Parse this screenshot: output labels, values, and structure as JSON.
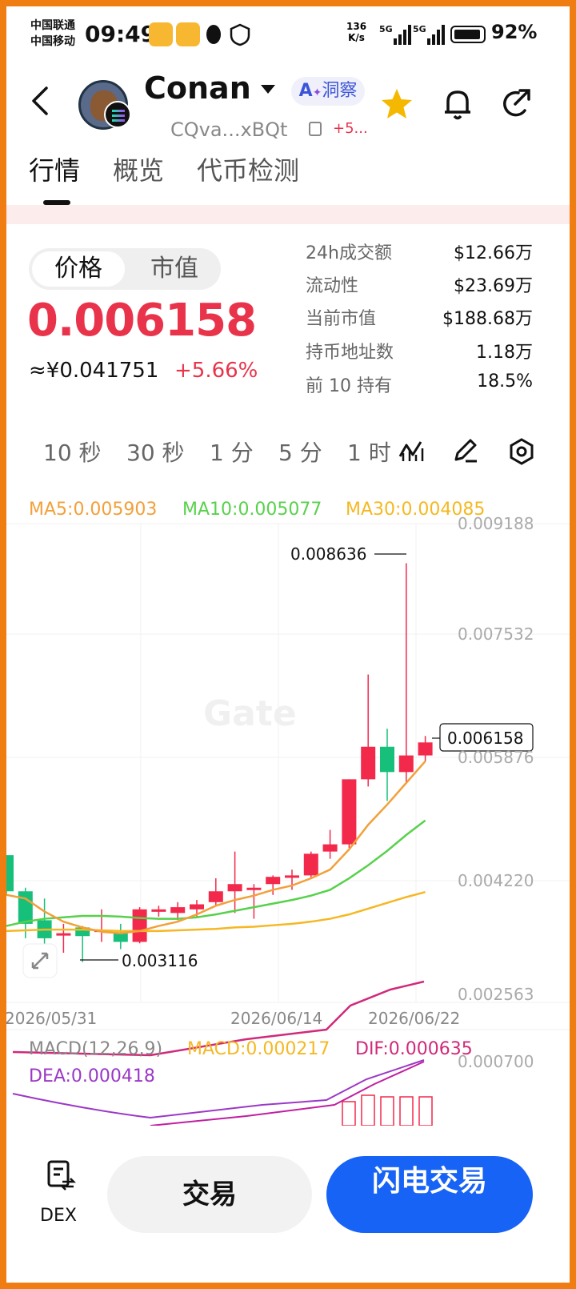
{
  "status_bar": {
    "carrier1": "中国联通",
    "carrier2": "中国移动",
    "time": "09:49",
    "speed_value": "136",
    "speed_unit": "K/s",
    "net1": "5G",
    "net2": "5G",
    "battery": "92%"
  },
  "header": {
    "token_name": "Conan",
    "ai_label": "洞察",
    "address": "CQva...xBQt",
    "change_short": "+5..."
  },
  "tabs": [
    "行情",
    "概览",
    "代币检测"
  ],
  "price_panel": {
    "toggle_price": "价格",
    "toggle_mcap": "市值",
    "price": "0.006158",
    "cny_price": "≈¥0.041751",
    "change_pct": "+5.66%"
  },
  "stats": [
    {
      "label": "24h成交额",
      "value": "$12.66万"
    },
    {
      "label": "流动性",
      "value": "$23.69万"
    },
    {
      "label": "当前市值",
      "value": "$188.68万"
    },
    {
      "label": "持币地址数",
      "value": "1.18万"
    },
    {
      "label": "前 10 持有",
      "value": "18.5%"
    }
  ],
  "intervals": [
    "10 秒",
    "30 秒",
    "1 分",
    "5 分",
    "1 时"
  ],
  "chart": {
    "ma5": "MA5:0.005903",
    "ma10": "MA10:0.005077",
    "ma30": "MA30:0.004085",
    "watermark": "Gate",
    "y_labels": [
      "0.009188",
      "0.007532",
      "0.005876",
      "0.004220",
      "0.002563"
    ],
    "x_labels": [
      "2026/05/31",
      "2026/06/14",
      "2026/06/22"
    ],
    "high_label": "0.008636",
    "low_label": "0.003116",
    "current_label": "0.006158",
    "macd_title": "MACD(12,26,9)",
    "macd_value": "MACD:0.000217",
    "dif_value": "DIF:0.000635",
    "dea_value": "DEA:0.000418",
    "macd_ylabel": "0.000700"
  },
  "chart_data": {
    "type": "candlestick",
    "y_range": [
      0.002563,
      0.009188
    ],
    "candles": [
      {
        "o": 0.0046,
        "c": 0.0041,
        "h": 0.0046,
        "l": 0.00405
      },
      {
        "o": 0.0041,
        "c": 0.00365,
        "h": 0.00415,
        "l": 0.00345
      },
      {
        "o": 0.0037,
        "c": 0.00345,
        "h": 0.004,
        "l": 0.00335
      },
      {
        "o": 0.00352,
        "c": 0.00352,
        "h": 0.00365,
        "l": 0.00325
      },
      {
        "o": 0.0036,
        "c": 0.00348,
        "h": 0.00362,
        "l": 0.00312
      },
      {
        "o": 0.00355,
        "c": 0.00357,
        "h": 0.00385,
        "l": 0.0034
      },
      {
        "o": 0.00352,
        "c": 0.0034,
        "h": 0.00365,
        "l": 0.0033
      },
      {
        "o": 0.0034,
        "c": 0.00385,
        "h": 0.00388,
        "l": 0.00338
      },
      {
        "o": 0.00385,
        "c": 0.00385,
        "h": 0.0039,
        "l": 0.00375
      },
      {
        "o": 0.0038,
        "c": 0.00388,
        "h": 0.00395,
        "l": 0.0037
      },
      {
        "o": 0.00385,
        "c": 0.00392,
        "h": 0.00398,
        "l": 0.00375
      },
      {
        "o": 0.00395,
        "c": 0.0041,
        "h": 0.00428,
        "l": 0.0039
      },
      {
        "o": 0.0041,
        "c": 0.0042,
        "h": 0.00465,
        "l": 0.0038
      },
      {
        "o": 0.00415,
        "c": 0.00415,
        "h": 0.0042,
        "l": 0.00372
      },
      {
        "o": 0.0042,
        "c": 0.0043,
        "h": 0.00432,
        "l": 0.00405
      },
      {
        "o": 0.0043,
        "c": 0.00432,
        "h": 0.0044,
        "l": 0.00412
      },
      {
        "o": 0.00432,
        "c": 0.00462,
        "h": 0.00465,
        "l": 0.00428
      },
      {
        "o": 0.00465,
        "c": 0.00475,
        "h": 0.00495,
        "l": 0.00455
      },
      {
        "o": 0.00475,
        "c": 0.00565,
        "h": 0.00565,
        "l": 0.0047
      },
      {
        "o": 0.00565,
        "c": 0.0061,
        "h": 0.0071,
        "l": 0.00555
      },
      {
        "o": 0.0061,
        "c": 0.00575,
        "h": 0.00635,
        "l": 0.00535
      },
      {
        "o": 0.00575,
        "c": 0.00598,
        "h": 0.00864,
        "l": 0.0056
      },
      {
        "o": 0.00598,
        "c": 0.00616,
        "h": 0.00625,
        "l": 0.0059
      }
    ],
    "ma5": [
      0.00405,
      0.004,
      0.00382,
      0.00368,
      0.0036,
      0.00354,
      0.00352,
      0.00355,
      0.00362,
      0.00368,
      0.00378,
      0.0039,
      0.00398,
      0.00404,
      0.00412,
      0.00418,
      0.00428,
      0.0044,
      0.00468,
      0.00502,
      0.0053,
      0.0056,
      0.0059
    ],
    "ma10": [
      0.00362,
      0.00368,
      0.00372,
      0.00374,
      0.00376,
      0.00376,
      0.00375,
      0.00373,
      0.00372,
      0.00372,
      0.00374,
      0.00378,
      0.00383,
      0.00388,
      0.00393,
      0.00398,
      0.00404,
      0.00412,
      0.00428,
      0.00446,
      0.00466,
      0.00488,
      0.00508
    ],
    "ma30": [
      0.00355,
      0.00356,
      0.00357,
      0.00357,
      0.00357,
      0.00356,
      0.00355,
      0.00355,
      0.00355,
      0.00356,
      0.00357,
      0.00358,
      0.0036,
      0.00361,
      0.00363,
      0.00365,
      0.00368,
      0.00372,
      0.00378,
      0.00386,
      0.00394,
      0.00402,
      0.00409
    ]
  },
  "bottom": {
    "dex": "DEX",
    "trade": "交易",
    "flash_trade": "闪电交易"
  },
  "colors": {
    "up": "#f2294b",
    "down": "#17c07a",
    "ma5": "#f2a03a",
    "ma10": "#58d14c",
    "ma30": "#f5b823",
    "accent": "#1663f5",
    "frame": "#f07d12"
  }
}
